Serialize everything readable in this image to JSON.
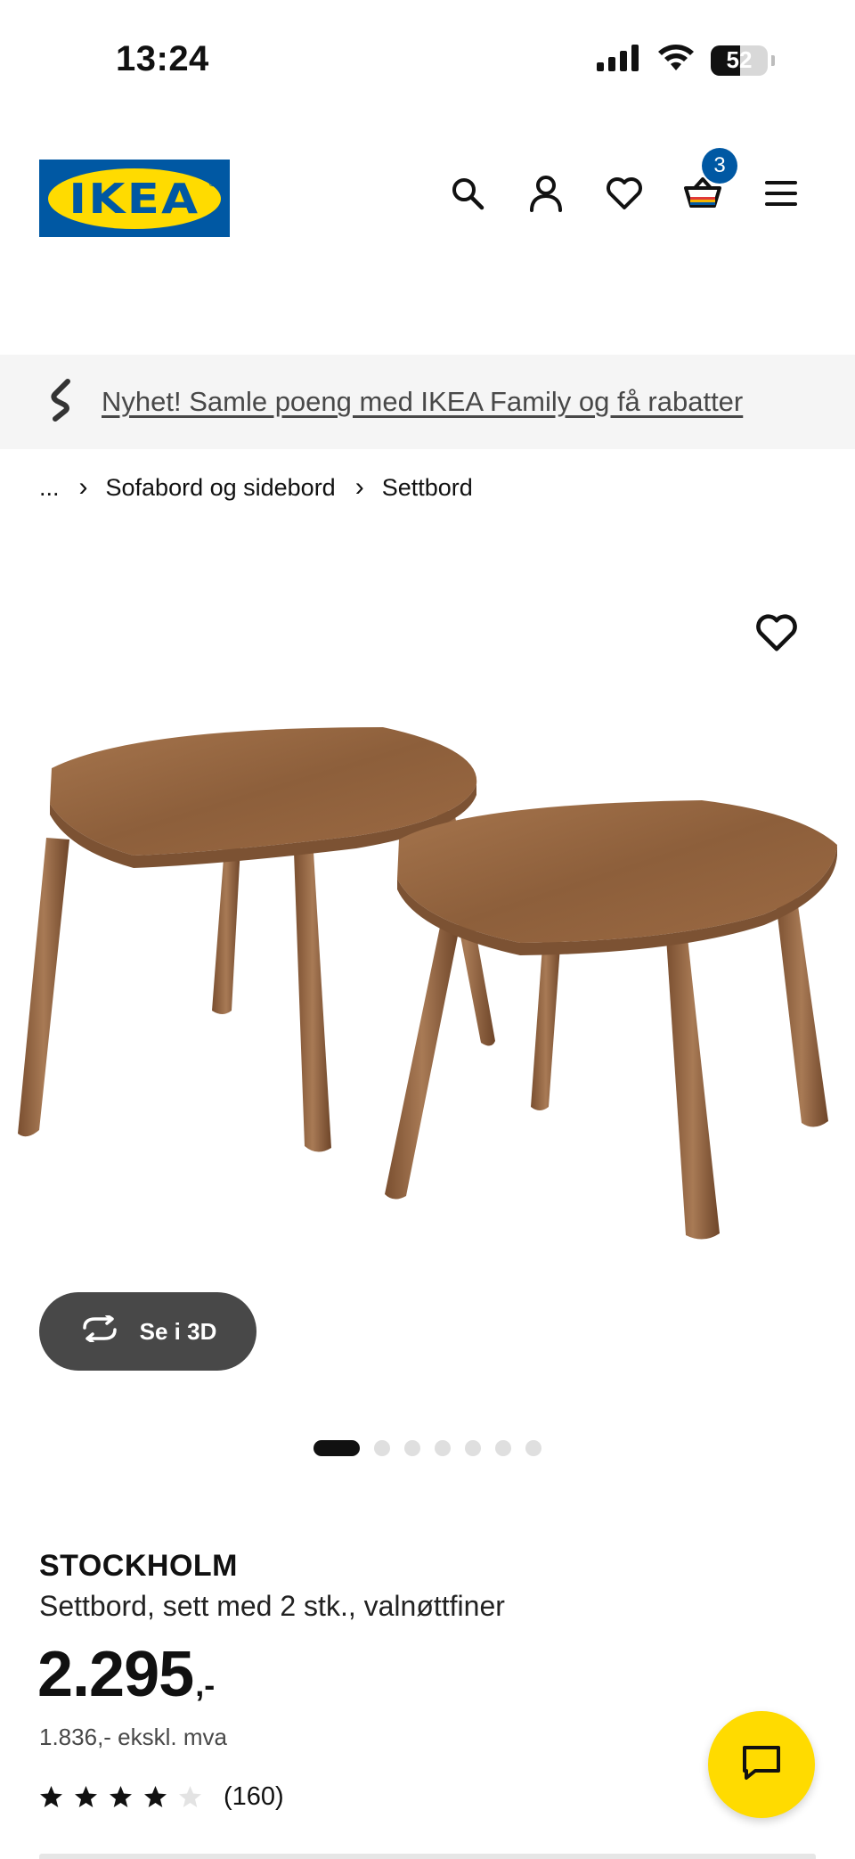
{
  "status_bar": {
    "time": "13:24",
    "battery_level": "52",
    "battery_percent": 52,
    "icons": [
      "signal-icon",
      "wifi-icon",
      "battery-icon"
    ]
  },
  "header": {
    "logo_text": "IKEA",
    "logo_mark": "®",
    "cart_count": "3",
    "icons": [
      "search-icon",
      "user-icon",
      "heart-icon",
      "cart-icon",
      "menu-icon"
    ]
  },
  "promo": {
    "text": "Nyhet! Samle poeng med IKEA Family og få rabatter",
    "icon": "ikea-family-icon"
  },
  "breadcrumb": {
    "items": [
      "...",
      "Sofabord og sidebord",
      "Settbord"
    ],
    "separator": "›"
  },
  "gallery": {
    "button_3d_label": "Se i 3D",
    "image_count": 7,
    "active_index": 0
  },
  "product": {
    "name": "STOCKHOLM",
    "description": "Settbord, sett med 2 stk., valnøttfiner",
    "price": "2.295",
    "price_suffix": ",-",
    "price_ex_vat": "1.836,- ekskl. mva",
    "rating_value": 4,
    "rating_max": 5,
    "review_count": "(160)"
  },
  "colors": {
    "ikea_blue": "#0058a3",
    "ikea_yellow": "#ffdb00",
    "dark_button": "#484848",
    "wood": "#9a6a45"
  }
}
